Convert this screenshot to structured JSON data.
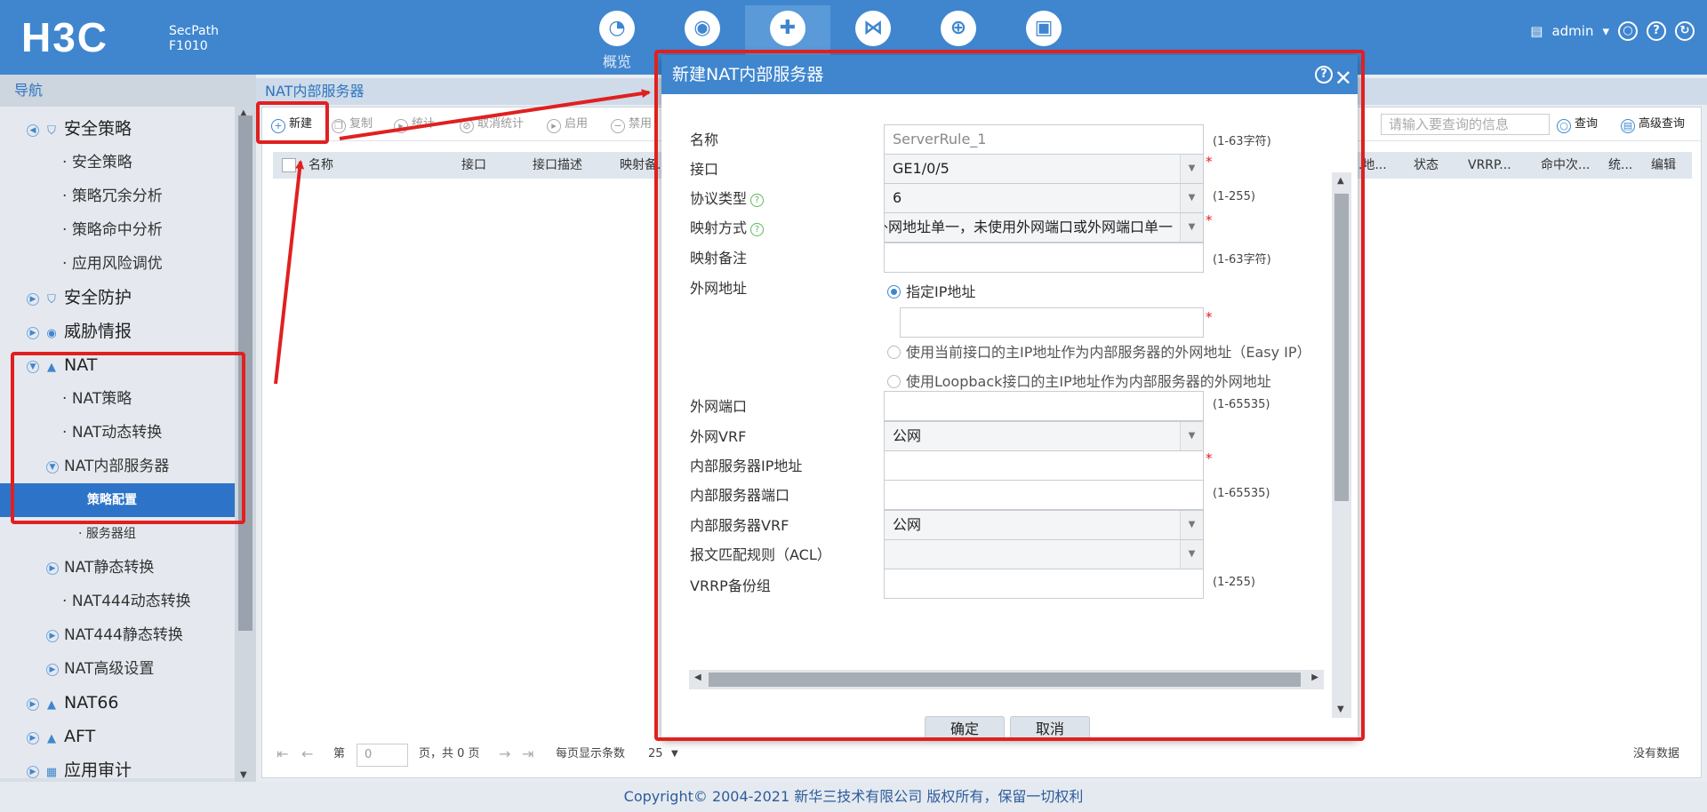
{
  "header": {
    "logo": "H3C",
    "model_line1": "SecPath",
    "model_line2": "F1010",
    "overview_label": "概览",
    "user": "admin",
    "nav_icons": [
      "dashboard-icon",
      "monitor-icon",
      "shield-icon",
      "share-icon",
      "globe-icon",
      "screen-icon"
    ]
  },
  "sidebar": {
    "title": "导航",
    "items": [
      {
        "label": "安全策略",
        "level": 1,
        "icon": "shield-icon"
      },
      {
        "label": "安全策略",
        "level": 2
      },
      {
        "label": "策略冗余分析",
        "level": 2
      },
      {
        "label": "策略命中分析",
        "level": 2
      },
      {
        "label": "应用风险调优",
        "level": 2
      },
      {
        "label": "安全防护",
        "level": 1,
        "icon": "shield-icon"
      },
      {
        "label": "威胁情报",
        "level": 1,
        "icon": "eye-icon"
      },
      {
        "label": "NAT",
        "level": 1,
        "icon": "network-icon"
      },
      {
        "label": "NAT策略",
        "level": 2
      },
      {
        "label": "NAT动态转换",
        "level": 2
      },
      {
        "label": "NAT内部服务器",
        "level": 2,
        "expandable": true
      },
      {
        "label": "策略配置",
        "level": 3,
        "selected": true
      },
      {
        "label": "服务器组",
        "level": 3
      },
      {
        "label": "NAT静态转换",
        "level": 2,
        "expandable": true
      },
      {
        "label": "NAT444动态转换",
        "level": 2
      },
      {
        "label": "NAT444静态转换",
        "level": 2,
        "expandable": true
      },
      {
        "label": "NAT高级设置",
        "level": 2,
        "expandable": true
      },
      {
        "label": "NAT66",
        "level": 1,
        "icon": "network-icon"
      },
      {
        "label": "AFT",
        "level": 1,
        "icon": "network-icon"
      },
      {
        "label": "应用审计",
        "level": 1,
        "icon": "grid-icon"
      }
    ]
  },
  "breadcrumb": "NAT内部服务器",
  "toolbar": {
    "new": "新建",
    "copy": "复制",
    "stats": "统计",
    "cancel_stats": "取消统计",
    "enable": "启用",
    "disable": "禁用",
    "search_placeholder": "请输入要查询的信息",
    "search": "查询",
    "advanced_search": "高级查询"
  },
  "table": {
    "columns_left": [
      "名称",
      "接口",
      "接口描述",
      "映射备..."
    ],
    "columns_right": [
      "...地...",
      "状态",
      "VRRP...",
      "命中次...",
      "统...",
      "编辑"
    ]
  },
  "pager": {
    "page_prefix": "第",
    "page_value": "0",
    "page_suffix": "页，共 0 页",
    "per_page_label": "每页显示条数",
    "per_page_value": "25",
    "no_data": "没有数据"
  },
  "footer": "Copyright© 2004-2021 新华三技术有限公司 版权所有，保留一切权利",
  "dialog": {
    "title": "新建NAT内部服务器",
    "fields": {
      "name": {
        "label": "名称",
        "placeholder": "ServerRule_1",
        "hint": "(1-63字符)"
      },
      "interface": {
        "label": "接口",
        "value": "GE1/0/5"
      },
      "protocol": {
        "label": "协议类型",
        "value": "6",
        "hint": "(1-255)"
      },
      "mapping": {
        "label": "映射方式",
        "value": "外网地址单一，未使用外网端口或外网端口单一"
      },
      "remark": {
        "label": "映射备注",
        "hint": "(1-63字符)"
      },
      "public_address": {
        "label": "外网地址",
        "option_ip": "指定IP地址",
        "option_easyip": "使用当前接口的主IP地址作为内部服务器的外网地址（Easy IP）",
        "option_loopback": "使用Loopback接口的主IP地址作为内部服务器的外网地址"
      },
      "public_port": {
        "label": "外网端口",
        "hint": "(1-65535)"
      },
      "public_vrf": {
        "label": "外网VRF",
        "value": "公网"
      },
      "server_ip": {
        "label": "内部服务器IP地址"
      },
      "server_port": {
        "label": "内部服务器端口",
        "hint": "(1-65535)"
      },
      "server_vrf": {
        "label": "内部服务器VRF",
        "value": "公网"
      },
      "acl": {
        "label": "报文匹配规则（ACL）"
      },
      "vrrp": {
        "label": "VRRP备份组",
        "hint": "(1-255)"
      }
    },
    "required_mark": "*",
    "ok": "确定",
    "cancel": "取消"
  }
}
